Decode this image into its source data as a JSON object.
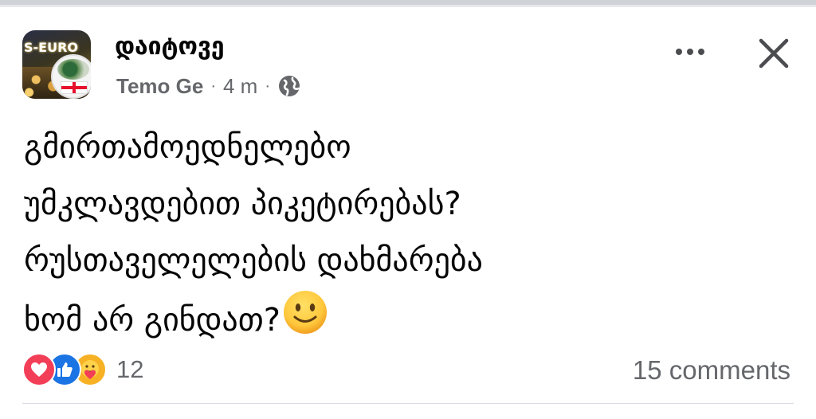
{
  "post": {
    "group_name": "დაიტოვე",
    "author": "Temo Ge",
    "separator": "·",
    "time": "4 m",
    "avatar_text": "S-EURO",
    "text_lines": [
      "გმირთამოედნელებო",
      "უმკლავდებით პიკეტირებას?",
      "რუსთაველელების დახმარება",
      "ხომ არ გინდათ?"
    ],
    "emoji": "slightly-smiling-face-icon"
  },
  "header": {
    "more_icon": "more-horizontal-icon",
    "close_icon": "close-icon"
  },
  "footer": {
    "reaction_icons": [
      "love-icon",
      "like-icon",
      "care-icon"
    ],
    "reaction_count": "12",
    "comments": "15 comments"
  },
  "colors": {
    "text": "#050505",
    "secondary": "#65676b",
    "love": "#f33e58",
    "like": "#1b74e4",
    "care": "#f7b125"
  }
}
